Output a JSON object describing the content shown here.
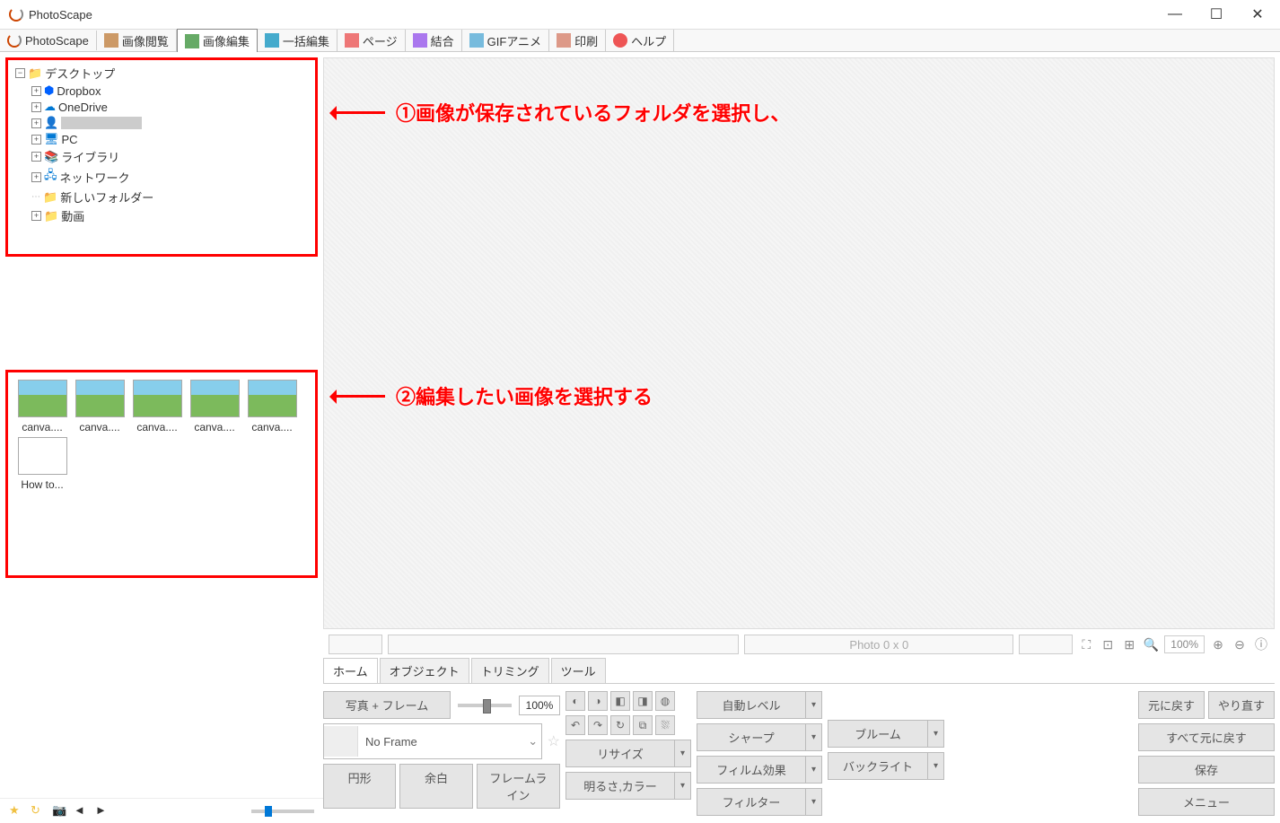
{
  "window": {
    "title": "PhotoScape"
  },
  "toolbar": {
    "tabs": [
      "PhotoScape",
      "画像閲覧",
      "画像編集",
      "一括編集",
      "ページ",
      "結合",
      "GIFアニメ",
      "印刷",
      "ヘルプ"
    ]
  },
  "tree": {
    "root": "デスクトップ",
    "items": [
      "Dropbox",
      "OneDrive",
      "",
      "PC",
      "ライブラリ",
      "ネットワーク",
      "新しいフォルダー",
      "動画"
    ]
  },
  "thumbs": {
    "items": [
      "canva....",
      "canva....",
      "canva....",
      "canva....",
      "canva....",
      "How to..."
    ]
  },
  "annotations": {
    "a1": "①画像が保存されているフォルダを選択し、",
    "a2": "②編集したい画像を選択する"
  },
  "infobar": {
    "photo": "Photo 0 x 0",
    "zoom": "100%"
  },
  "editor_tabs": [
    "ホーム",
    "オブジェクト",
    "トリミング",
    "ツール"
  ],
  "controls": {
    "frame_btn": "写真 + フレーム",
    "frame_pct": "100%",
    "no_frame": "No Frame",
    "round": "円形",
    "margin": "余白",
    "frameline": "フレームライン",
    "auto_level": "自動レベル",
    "sharpen": "シャープ",
    "resize": "リサイズ",
    "film": "フィルム効果",
    "bright_color": "明るさ,カラー",
    "filter": "フィルター",
    "bloom": "ブルーム",
    "backlight": "バックライト",
    "undo": "元に戻す",
    "redo": "やり直す",
    "undo_all": "すべて元に戻す",
    "save": "保存",
    "menu": "メニュー"
  }
}
